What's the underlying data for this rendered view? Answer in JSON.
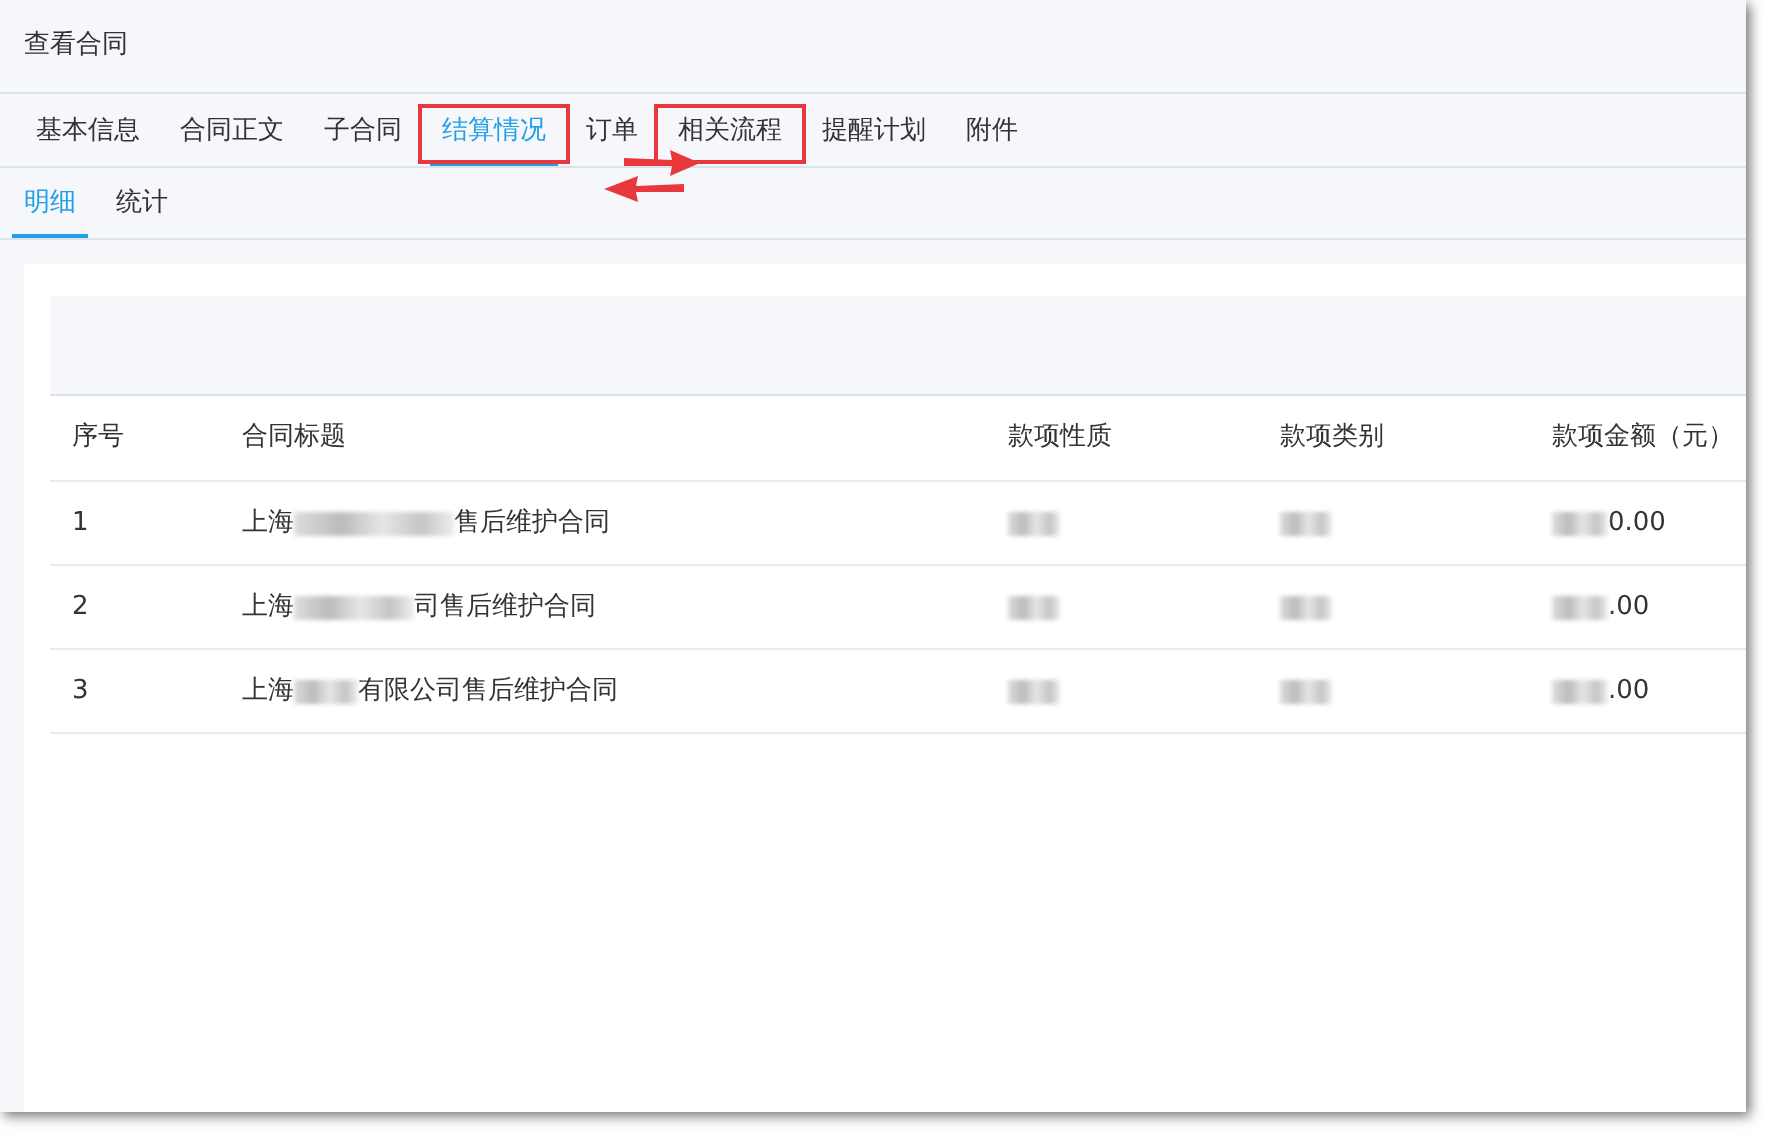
{
  "window": {
    "title": "查看合同"
  },
  "tabs": [
    {
      "label": "基本信息",
      "selected": false,
      "highlighted": false
    },
    {
      "label": "合同正文",
      "selected": false,
      "highlighted": false
    },
    {
      "label": "子合同",
      "selected": false,
      "highlighted": false
    },
    {
      "label": "结算情况",
      "selected": true,
      "highlighted": true
    },
    {
      "label": "订单",
      "selected": false,
      "highlighted": false
    },
    {
      "label": "相关流程",
      "selected": false,
      "highlighted": true
    },
    {
      "label": "提醒计划",
      "selected": false,
      "highlighted": false
    },
    {
      "label": "附件",
      "selected": false,
      "highlighted": false
    }
  ],
  "sub_tabs": [
    {
      "label": "明细",
      "selected": true
    },
    {
      "label": "统计",
      "selected": false
    }
  ],
  "table": {
    "columns": [
      "序号",
      "合同标题",
      "款项性质",
      "款项类别",
      "款项金额（元）"
    ],
    "rows": [
      [
        {
          "text": "1"
        },
        {
          "prefix": "上海",
          "redacted": true,
          "suffix": "售后维护合同"
        },
        {
          "redacted": true
        },
        {
          "redacted": true
        },
        {
          "redacted": true,
          "suffix": "0.00"
        }
      ],
      [
        {
          "text": "2"
        },
        {
          "prefix": "上海",
          "redacted": true,
          "suffix": "司售后维护合同"
        },
        {
          "redacted": true
        },
        {
          "redacted": true
        },
        {
          "redacted": true,
          "suffix": ".00"
        }
      ],
      [
        {
          "text": "3"
        },
        {
          "prefix": "上海",
          "redacted": true,
          "suffix": "有限公司售后维护合同"
        },
        {
          "redacted": true
        },
        {
          "redacted": true
        },
        {
          "redacted": true,
          "suffix": ".00"
        }
      ]
    ]
  }
}
